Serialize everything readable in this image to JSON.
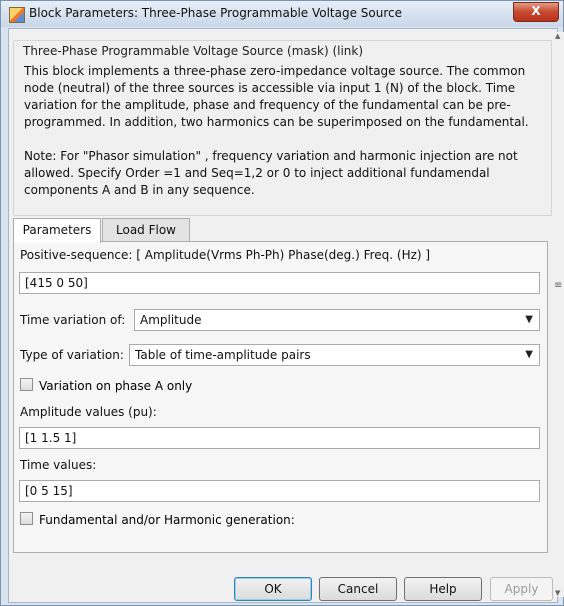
{
  "window": {
    "title": "Block Parameters: Three-Phase Programmable Voltage Source",
    "close_label": "X"
  },
  "group": {
    "title": "Three-Phase Programmable Voltage Source (mask) (link)",
    "description": "This block implements a three-phase zero-impedance voltage source. The common\nnode (neutral) of the three sources is accessible via input 1 (N) of the block. Time\nvariation for the amplitude, phase and frequency of the fundamental can be pre-\nprogrammed. In addition, two harmonics can be superimposed on the fundamental.",
    "note": "Note: For  \"Phasor simulation\" , frequency variation and harmonic injection are not\nallowed.  Specify  Order =1 and Seq=1,2 or 0 to inject additional fundamendal\ncomponents A and B in  any sequence."
  },
  "tabs": [
    {
      "label": "Parameters"
    },
    {
      "label": "Load Flow"
    }
  ],
  "params": {
    "positive_seq_label": "Positive-sequence: [ Amplitude(Vrms Ph-Ph)  Phase(deg.)  Freq. (Hz) ]",
    "positive_seq_value": "[415  0 50]",
    "time_variation_label": "Time variation of:",
    "time_variation_value": "Amplitude",
    "type_variation_label": "Type of variation:",
    "type_variation_value": "Table of time-amplitude pairs",
    "phase_a_only_label": "Variation on phase A only",
    "phase_a_only_checked": false,
    "amplitude_values_label": "Amplitude values (pu):",
    "amplitude_values_value": "[1 1.5 1]",
    "time_values_label": "Time values:",
    "time_values_value": "[0 5 15]",
    "harmonic_label": "Fundamental and/or Harmonic generation:",
    "harmonic_checked": false
  },
  "buttons": {
    "ok": "OK",
    "cancel": "Cancel",
    "help": "Help",
    "apply": "Apply"
  }
}
